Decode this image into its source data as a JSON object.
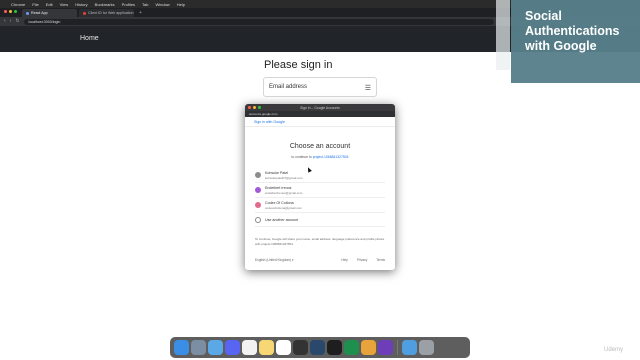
{
  "menubar": {
    "items": [
      "Chrome",
      "File",
      "Edit",
      "View",
      "History",
      "Bookmarks",
      "Profiles",
      "Tab",
      "Window",
      "Help"
    ]
  },
  "browser": {
    "tabs": [
      {
        "label": "React App",
        "active": true
      },
      {
        "label": "Client ID for Web application",
        "active": false
      }
    ],
    "url": "localhost:3000/login"
  },
  "page": {
    "nav_home": "Home",
    "signin_title": "Please sign in",
    "email_placeholder": "Email address"
  },
  "overlay": {
    "title": "Social Authentications with Google"
  },
  "popup": {
    "window_title": "Sign in – Google Accounts",
    "url": "accounts.google.com",
    "signin_link": "Sign in with Google",
    "choose_title": "Choose an account",
    "continue_prefix": "to continue to",
    "project": "project-1068841327504",
    "accounts": [
      {
        "name": "Kohsuke Patel",
        "email": "kohsukepatel07@gmail.com",
        "color": "#8d8d8d"
      },
      {
        "name": "Endelbert Irenos",
        "email": "endelbertirenos@gmail.com",
        "color": "#a259d9"
      },
      {
        "name": "Codex Of Coltona",
        "email": "codexofcoltona@gmail.com",
        "color": "#e46a8c"
      }
    ],
    "use_another": "Use another account",
    "disclaimer": "To continue, Google will share your name, email address, language preference and profile picture with project-1068841327504.",
    "footer": {
      "language": "English (United Kingdom)",
      "links": [
        "Help",
        "Privacy",
        "Terms"
      ]
    }
  },
  "dock": {
    "icons": [
      "finder-icon",
      "launchpad-icon",
      "mail-icon",
      "discord-icon",
      "calendar-icon",
      "notes-icon",
      "reminders-icon",
      "clock-icon",
      "photoshop-icon",
      "terminal-icon",
      "excel-icon",
      "chrome-icon",
      "visual-studio-icon",
      "files-icon",
      "trash-icon"
    ],
    "colors": [
      "#3a8ee6",
      "#7b8ea3",
      "#5aa9e6",
      "#5865f2",
      "#f2f2f2",
      "#f7d774",
      "#ffffff",
      "#333333",
      "#29486b",
      "#1e1e1e",
      "#1f8f4e",
      "#e8a33a",
      "#6e3db8",
      "#4f9fe0",
      "#9aa0a6"
    ]
  },
  "watermark": "Udemy"
}
